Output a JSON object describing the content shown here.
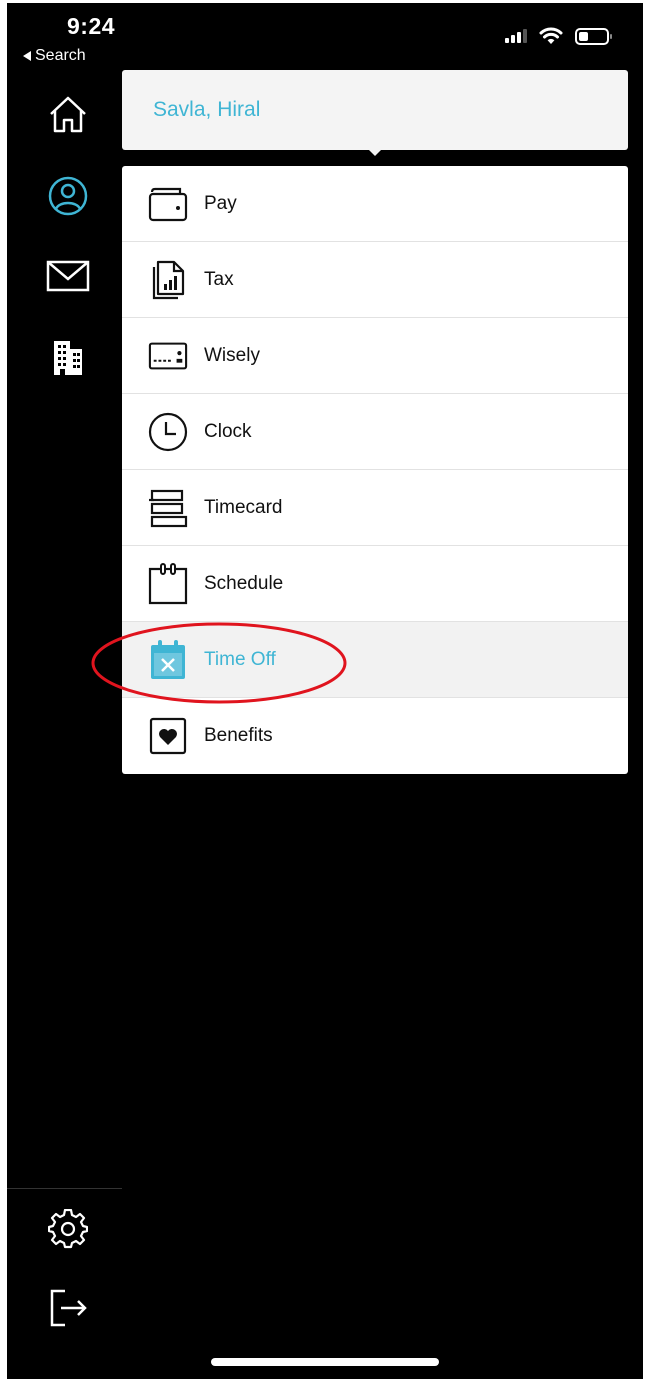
{
  "status_bar": {
    "time": "9:24",
    "back_label": "Search",
    "icons": [
      "signal-icon",
      "wifi-icon",
      "battery-icon"
    ]
  },
  "sidebar": {
    "items": [
      {
        "icon": "home-icon"
      },
      {
        "icon": "profile-icon",
        "active": true
      },
      {
        "icon": "mail-icon"
      },
      {
        "icon": "building-icon"
      }
    ],
    "bottom": [
      {
        "icon": "gear-icon"
      },
      {
        "icon": "logout-icon"
      }
    ]
  },
  "dropdown": {
    "user_name": "Savla, Hiral",
    "items": [
      {
        "label": "Pay",
        "icon": "wallet-icon"
      },
      {
        "label": "Tax",
        "icon": "tax-document-icon"
      },
      {
        "label": "Wisely",
        "icon": "card-icon"
      },
      {
        "label": "Clock",
        "icon": "clock-icon"
      },
      {
        "label": "Timecard",
        "icon": "timecard-icon"
      },
      {
        "label": "Schedule",
        "icon": "schedule-calendar-icon"
      },
      {
        "label": "Time Off",
        "icon": "time-off-calendar-icon",
        "active": true
      },
      {
        "label": "Benefits",
        "icon": "benefits-heart-icon"
      }
    ]
  },
  "colors": {
    "accent": "#3fb5d4",
    "annotation": "#e0141e",
    "background": "#000000",
    "menu_bg": "#ffffff"
  }
}
